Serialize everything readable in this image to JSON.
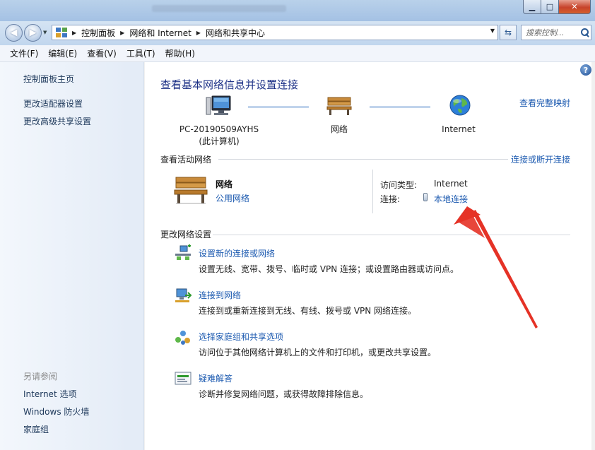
{
  "window": {
    "controls": {
      "minimize": "▁",
      "maximize": "□",
      "close": "✕"
    }
  },
  "address_bar": {
    "breadcrumb": [
      "控制面板",
      "网络和 Internet",
      "网络和共享中心"
    ],
    "search_placeholder": "搜索控制..."
  },
  "menu": [
    "文件(F)",
    "编辑(E)",
    "查看(V)",
    "工具(T)",
    "帮助(H)"
  ],
  "sidebar": {
    "links": [
      "控制面板主页",
      "更改适配器设置",
      "更改高级共享设置"
    ],
    "see_also_heading": "另请参阅",
    "see_also": [
      "Internet 选项",
      "Windows 防火墙",
      "家庭组"
    ]
  },
  "main": {
    "title": "查看基本网络信息并设置连接",
    "full_map_link": "查看完整映射",
    "map": {
      "computer_name": "PC-20190509AYHS",
      "computer_sub": "(此计算机)",
      "network": "网络",
      "internet": "Internet"
    },
    "active_networks": {
      "heading": "查看活动网络",
      "connect_link": "连接或断开连接",
      "network_name": "网络",
      "network_type": "公用网络",
      "access_type_label": "访问类型:",
      "access_type_value": "Internet",
      "connection_label": "连接:",
      "connection_value": "本地连接"
    },
    "change_settings": {
      "heading": "更改网络设置",
      "tasks": [
        {
          "title": "设置新的连接或网络",
          "desc": "设置无线、宽带、拨号、临时或 VPN 连接；或设置路由器或访问点。"
        },
        {
          "title": "连接到网络",
          "desc": "连接到或重新连接到无线、有线、拨号或 VPN 网络连接。"
        },
        {
          "title": "选择家庭组和共享选项",
          "desc": "访问位于其他网络计算机上的文件和打印机，或更改共享设置。"
        },
        {
          "title": "疑难解答",
          "desc": "诊断并修复网络问题，或获得故障排除信息。"
        }
      ]
    }
  },
  "colors": {
    "link": "#1c5ab0",
    "title": "#1e3287",
    "arrow": "#e53226"
  }
}
